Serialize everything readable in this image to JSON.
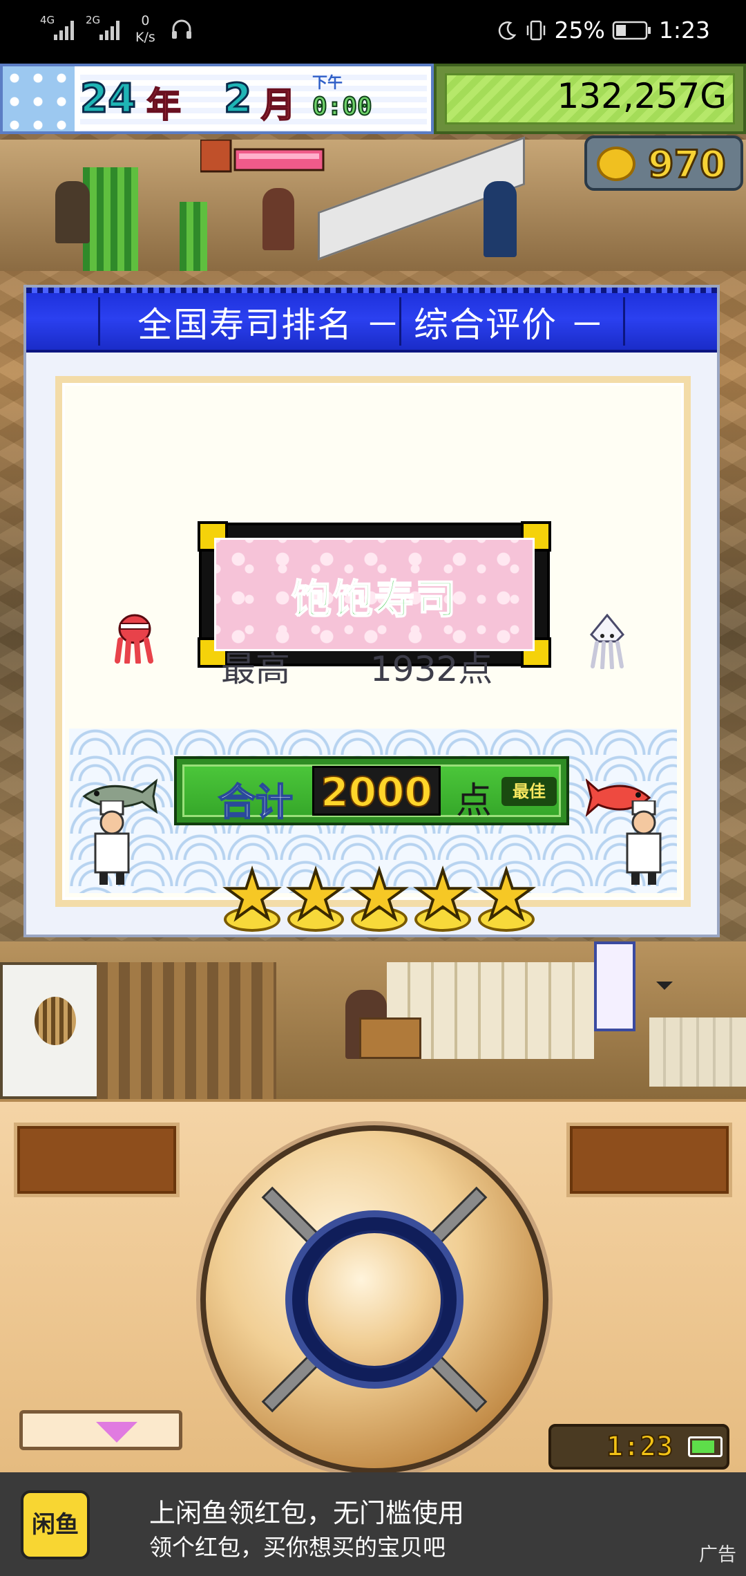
{
  "status_bar": {
    "signal1": "4G",
    "signal2": "2G",
    "net_speed_value": "0",
    "net_speed_unit": "K/s",
    "battery_percent": "25%",
    "time": "1:23"
  },
  "hud": {
    "year_num": "24",
    "year_unit": "年",
    "month_num": "2",
    "month_unit": "月",
    "period": "下午",
    "clock": "0:00",
    "money": "132,257G",
    "coins": "970"
  },
  "dialog": {
    "title": "全国寿司排名 － 综合评价 －",
    "shop_name": "饱饱寿司",
    "best_label": "最高",
    "best_score": "1932点",
    "total_label": "合计",
    "total_value": "2000",
    "total_unit": "点",
    "best_badge": "最佳",
    "stars": 5
  },
  "controller": {
    "clock": "1:23"
  },
  "ad": {
    "logo_text": "闲鱼",
    "line1": "上闲鱼领红包，无门槛使用",
    "line2": "领个红包，买你想买的宝贝吧",
    "tag": "广告"
  }
}
